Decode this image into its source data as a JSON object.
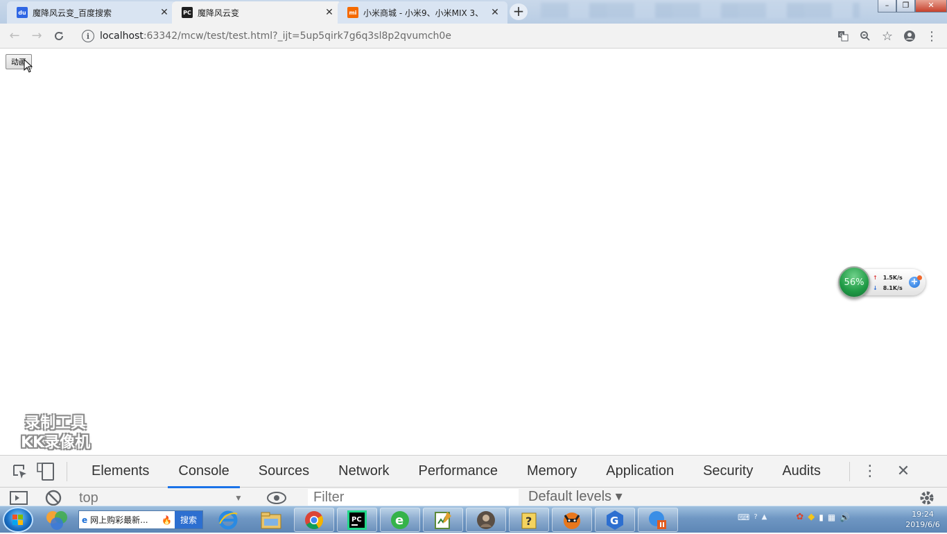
{
  "browser": {
    "tabs": [
      {
        "title": "魔降风云变_百度搜索",
        "favicon_color": "#2f66e4",
        "favicon_text": "du"
      },
      {
        "title": "魔降风云变",
        "favicon_color": "#1f1f1f",
        "favicon_text": "PC"
      },
      {
        "title": "小米商城 - 小米9、小米MIX 3、",
        "favicon_color": "#f56a00",
        "favicon_text": "mi"
      }
    ],
    "new_tab_label": "+",
    "url_host": "localhost",
    "url_rest": ":63342/mcw/test/test.html?_ijt=5up5qirk7g6q3sl8p2qvumch0e"
  },
  "page": {
    "button_label": "动画"
  },
  "watermark": {
    "line1": "录制工具",
    "line2": "KK录像机"
  },
  "net_widget": {
    "percent": "56%",
    "upload": "1.5K/s",
    "download": "8.1K/s"
  },
  "devtools": {
    "tabs": [
      "Elements",
      "Console",
      "Sources",
      "Network",
      "Performance",
      "Memory",
      "Application",
      "Security",
      "Audits"
    ],
    "active_tab": "Console",
    "context": "top",
    "filter_placeholder": "Filter",
    "levels": "Default levels ▾"
  },
  "taskbar": {
    "search_text": "网上购彩最新...",
    "search_button": "搜索",
    "time": "19:24",
    "date": "2019/6/6"
  },
  "colors": {
    "accent": "#1a73e8",
    "taskbar": "#6f97c3"
  }
}
